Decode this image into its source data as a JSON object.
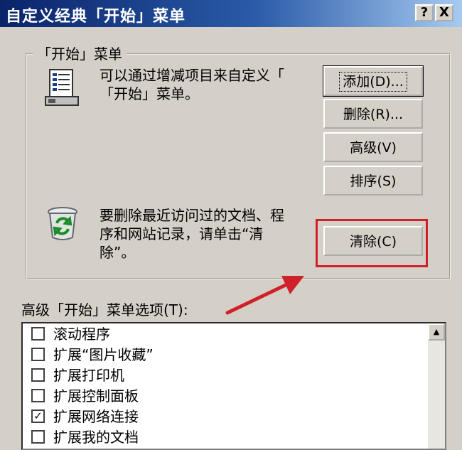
{
  "window": {
    "title": "自定义经典「开始」菜单",
    "help_label": "?",
    "close_label": "X"
  },
  "group": {
    "label": "「开始」菜单",
    "description_line1": "可以通过增减项目来自定义「",
    "description_line2": "「开始」菜单。",
    "clear_text_line1": "要删除最近访问过的文档、程",
    "clear_text_line2": "序和网站记录，请单击“清",
    "clear_text_line3": "除”。"
  },
  "buttons": {
    "add": "添加(D)...",
    "delete": "删除(R)...",
    "advanced": "高级(V)",
    "sort": "排序(S)",
    "clear": "清除(C)"
  },
  "advanced_options": {
    "label": "高级「开始」菜单选项(T):",
    "items": [
      {
        "label": "滚动程序",
        "checked": false
      },
      {
        "label": "扩展“图片收藏”",
        "checked": false
      },
      {
        "label": "扩展打印机",
        "checked": false
      },
      {
        "label": "扩展控制面板",
        "checked": false
      },
      {
        "label": "扩展网络连接",
        "checked": true
      },
      {
        "label": "扩展我的文档",
        "checked": false
      }
    ]
  },
  "colors": {
    "titlebar": "#0a246a",
    "highlight": "#d0202a",
    "arrow": "#d0202a"
  },
  "icons": {
    "menu": "start-menu-list-icon",
    "recycle": "recycle-bin-icon",
    "arrow": "annotation-arrow-icon"
  }
}
